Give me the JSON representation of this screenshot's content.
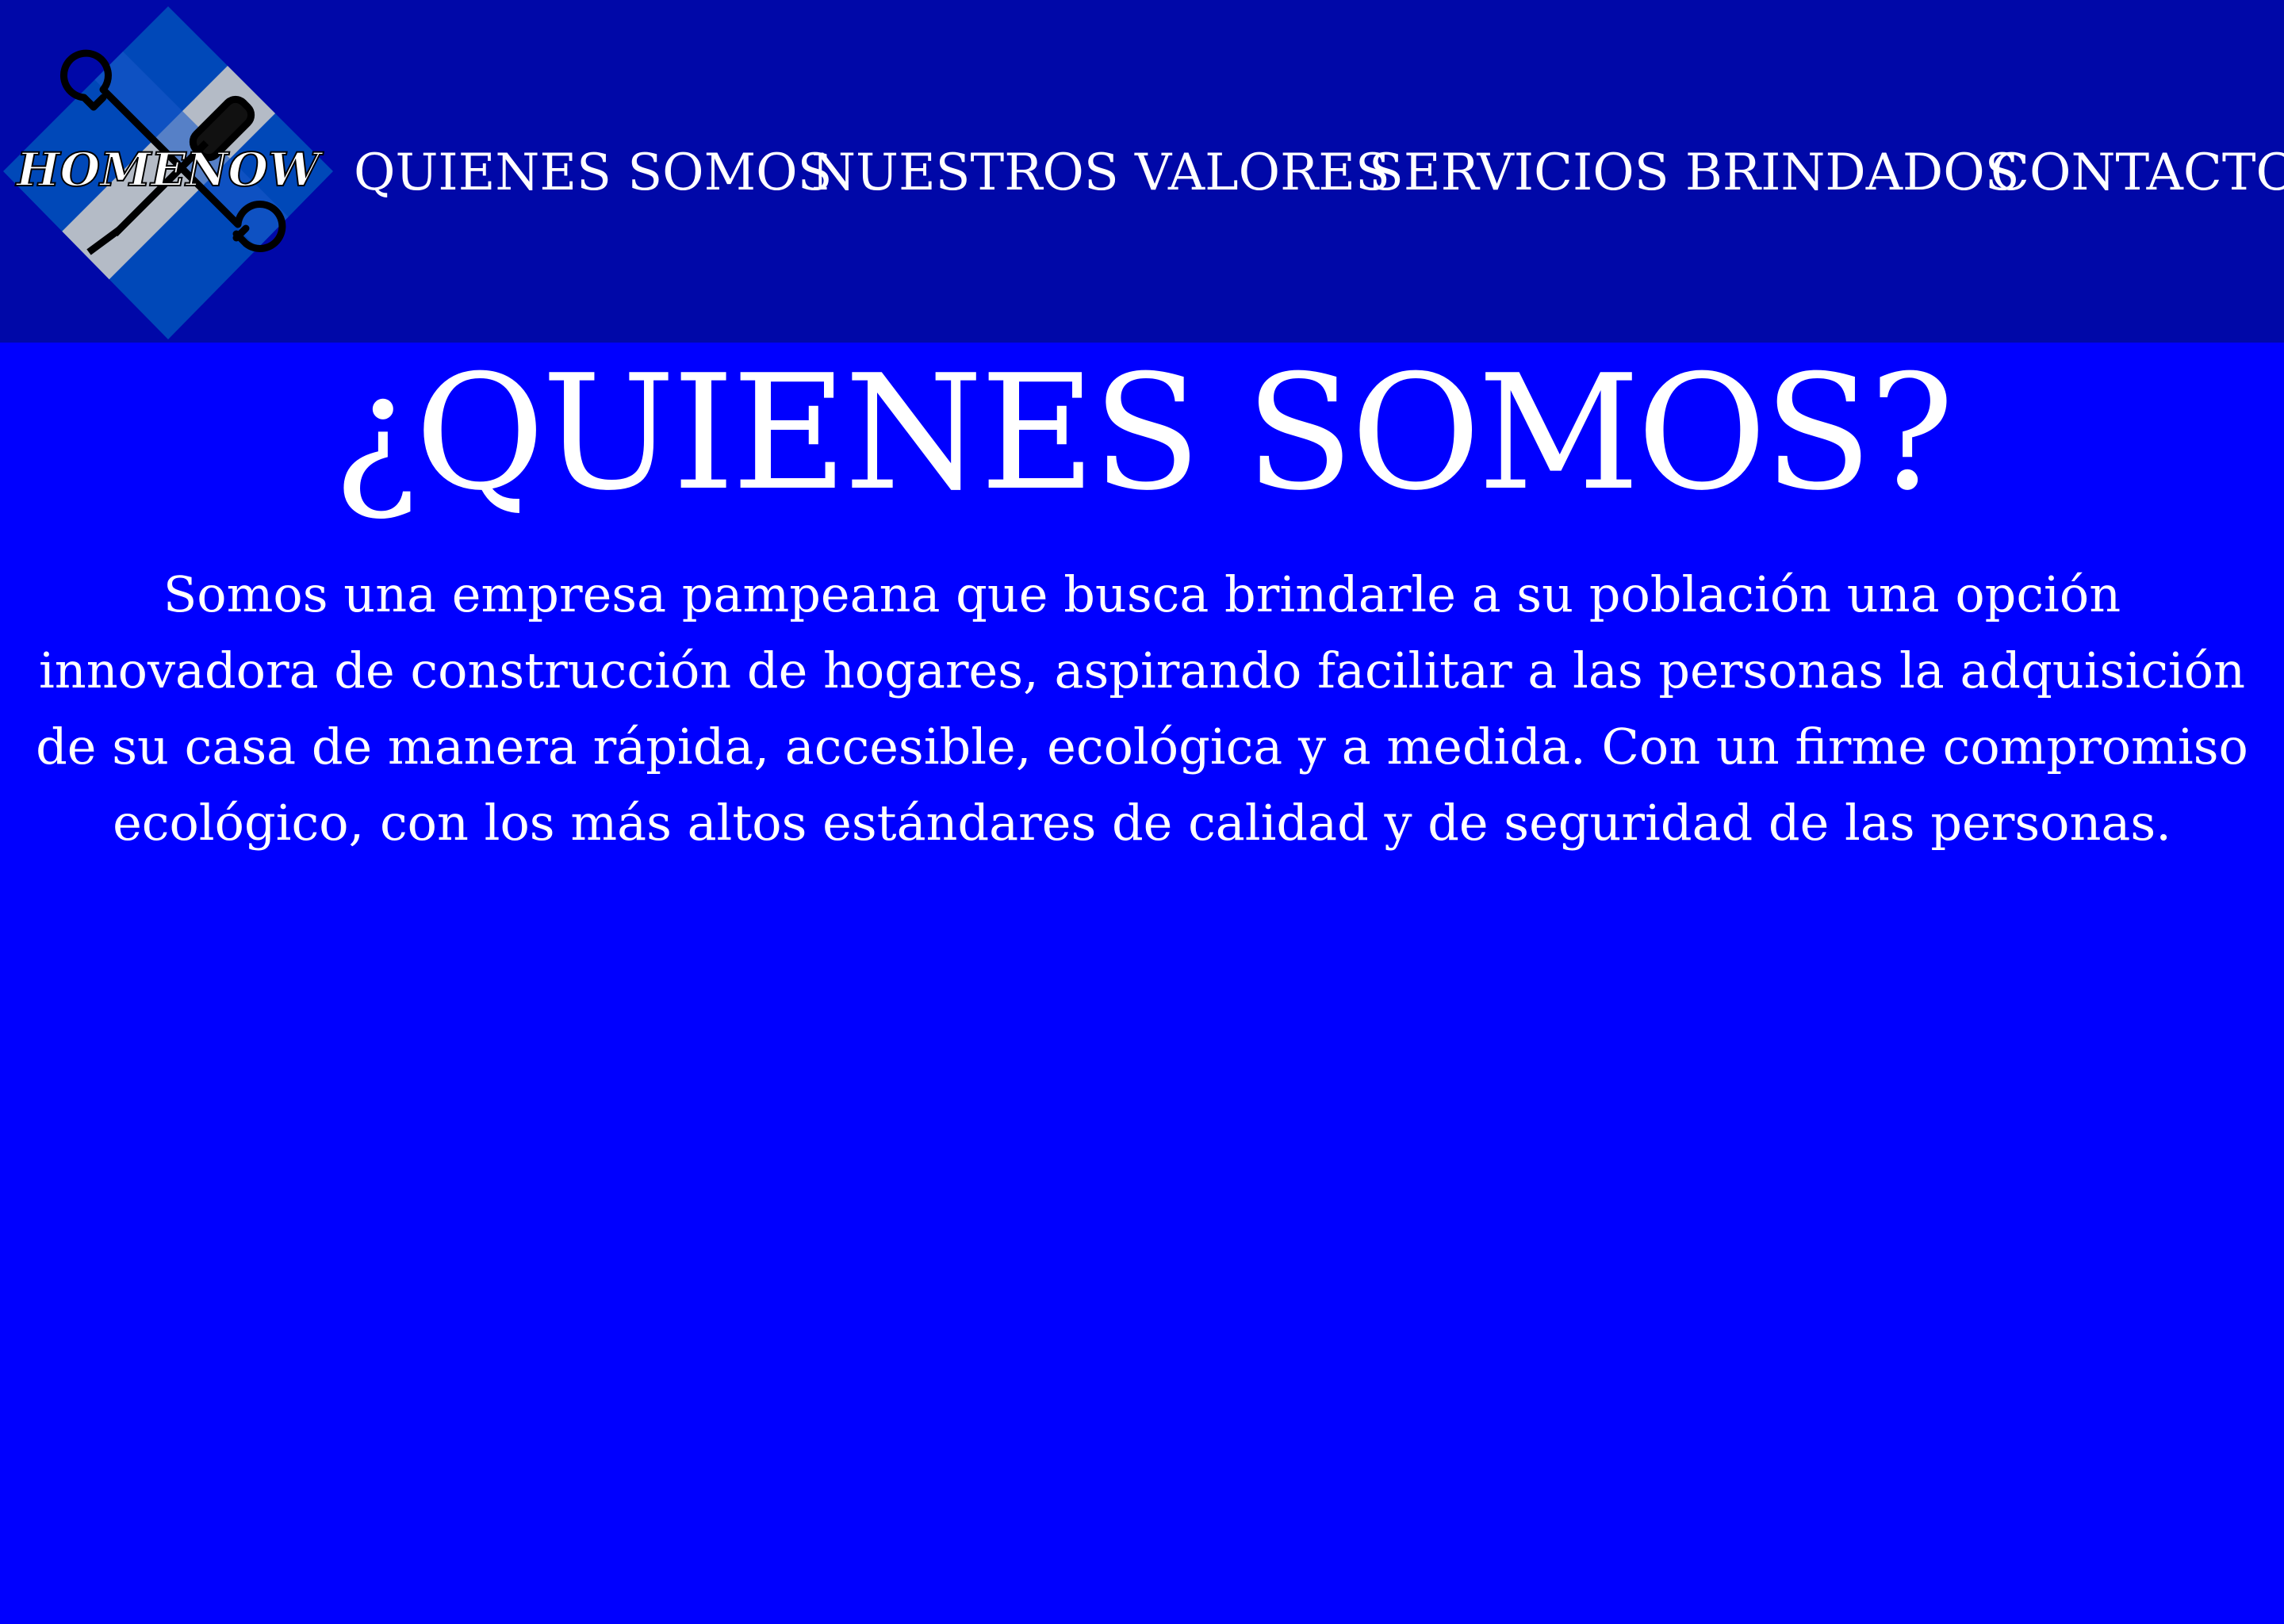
{
  "brand": {
    "logo_text": "HOMENOW",
    "colors": {
      "header_bg": "#0008a8",
      "page_bg": "#0000ff",
      "logo_diamond": "#0048b8",
      "logo_stripe": "#c8c8c8",
      "text": "#ffffff"
    }
  },
  "nav": {
    "items": [
      {
        "label": "QUIENES SOMOS"
      },
      {
        "label": "NUESTROS VALORES"
      },
      {
        "label": "SERVICIOS BRINDADOS"
      },
      {
        "label": "CONTACTO"
      }
    ]
  },
  "main": {
    "title": "¿QUIENES SOMOS?",
    "intro": "Somos una empresa pampeana que busca brindarle a su población una opción innovadora de construcción de hogares, aspirando facilitar a las personas la adquisición de su casa de manera rápida, accesible, ecológica y a medida. Con un firme compromiso ecológico, con los más altos estándares de calidad y de seguridad de las personas."
  }
}
